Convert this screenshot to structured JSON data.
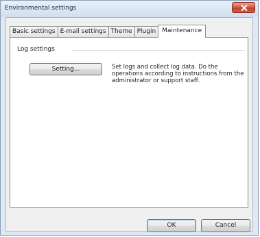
{
  "window": {
    "title": "Environmental settings",
    "close_icon": "close-icon"
  },
  "tabs": [
    {
      "label": "Basic settings",
      "active": false
    },
    {
      "label": "E-mail settings",
      "active": false
    },
    {
      "label": "Theme",
      "active": false
    },
    {
      "label": "Plugin",
      "active": false
    },
    {
      "label": "Maintenance",
      "active": true
    }
  ],
  "log_settings": {
    "group_label": "Log settings",
    "button_label": "Setting...",
    "description": "Set logs and collect log data. Do the operations according to instructions from the administrator or support staff."
  },
  "footer": {
    "ok_label": "OK",
    "cancel_label": "Cancel"
  }
}
